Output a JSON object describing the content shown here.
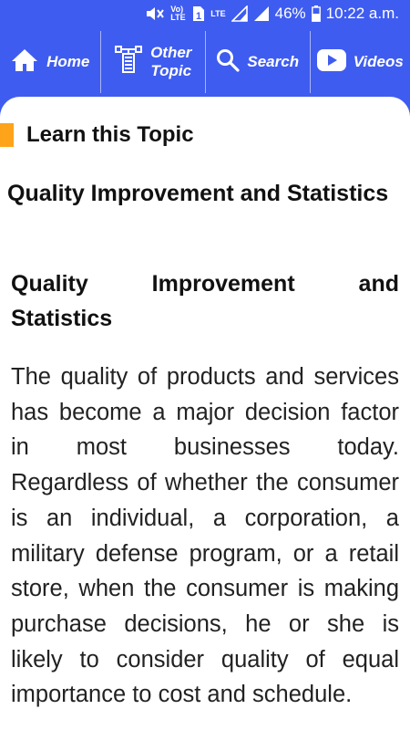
{
  "status_bar": {
    "volte_label": "Vo) LTE",
    "sim_label": "1",
    "lte_label": "LTE",
    "battery_percent": "46%",
    "time": "10:22 a.m."
  },
  "nav": {
    "home_label": "Home",
    "other_label_line1": "Other",
    "other_label_line2": "Topic",
    "search_label": "Search",
    "videos_label": "Videos"
  },
  "section": {
    "title": "Learn this Topic"
  },
  "topic": {
    "title": "Quality Improvement and Statistics"
  },
  "article": {
    "heading_line1": "Quality Improvement and",
    "heading_line2": "Statistics",
    "body": "The quality of products and services has become a major decision factor in most businesses today. Regardless of whether the consumer is an individual, a corporation, a military defense program, or a retail store, when the consumer is making purchase decisions, he or she is likely to consider quality of equal importance to cost and schedule."
  },
  "colors": {
    "primary": "#3f5cf0",
    "accent": "#ffa31a",
    "video_icon": "#3f5cf0"
  }
}
